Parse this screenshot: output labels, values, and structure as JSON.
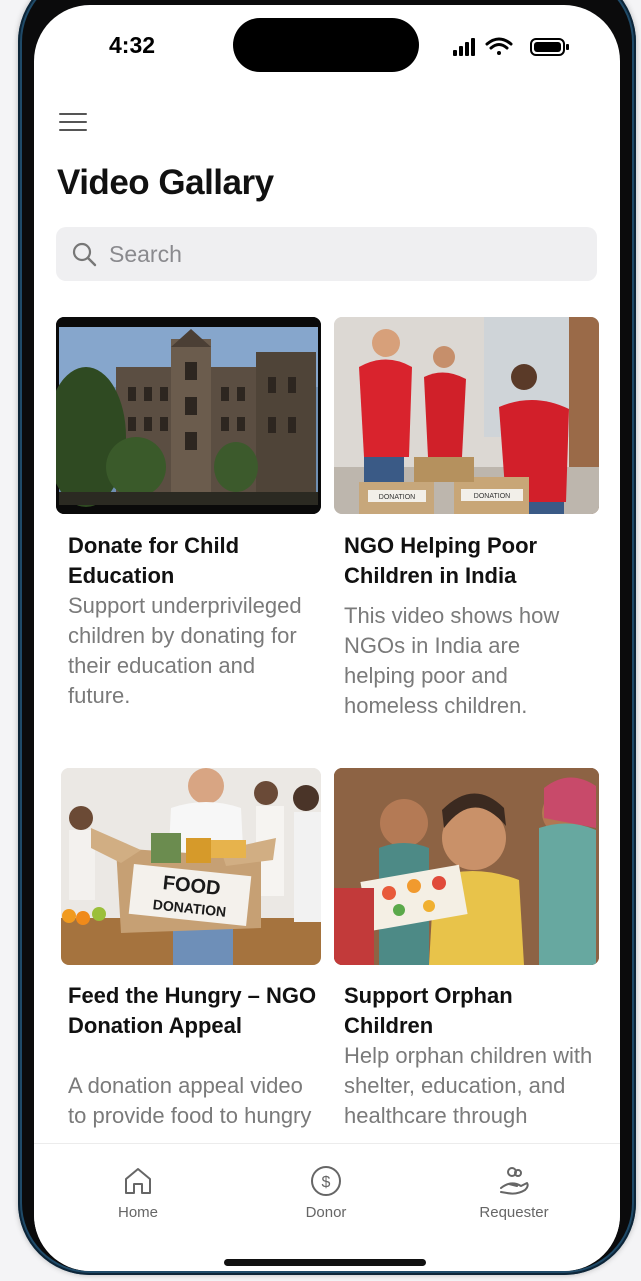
{
  "status_bar": {
    "time": "4:32"
  },
  "header": {
    "menu_icon": "hamburger-menu-icon",
    "title": "Video Gallary"
  },
  "search": {
    "placeholder": "Search",
    "value": "",
    "icon": "search-icon"
  },
  "videos": [
    {
      "title": "Donate for Child Education",
      "description": "Support underprivileged children by donating for their education and future."
    },
    {
      "title": "NGO Helping Poor Children in India",
      "description": "This video shows how NGOs in India are helping poor and homeless children."
    },
    {
      "title": "Feed the Hungry – NGO Donation Appeal",
      "description": "A donation appeal video to provide food to hungry"
    },
    {
      "title": "Support Orphan Children",
      "description": "Help orphan children with shelter, education, and healthcare through"
    }
  ],
  "thumbnail_text": {
    "donation_box_left": "DONATION",
    "donation_box_right": "DONATION",
    "food_box_line1": "FOOD",
    "food_box_line2": "DONATION"
  },
  "bottom_nav": [
    {
      "label": "Home",
      "icon": "home-icon"
    },
    {
      "label": "Donor",
      "icon": "dollar-circle-icon"
    },
    {
      "label": "Requester",
      "icon": "hand-heart-icon"
    }
  ],
  "colors": {
    "phone_frame": "#1f4a68",
    "search_bg": "#efeff1",
    "nav_label": "#666666"
  }
}
